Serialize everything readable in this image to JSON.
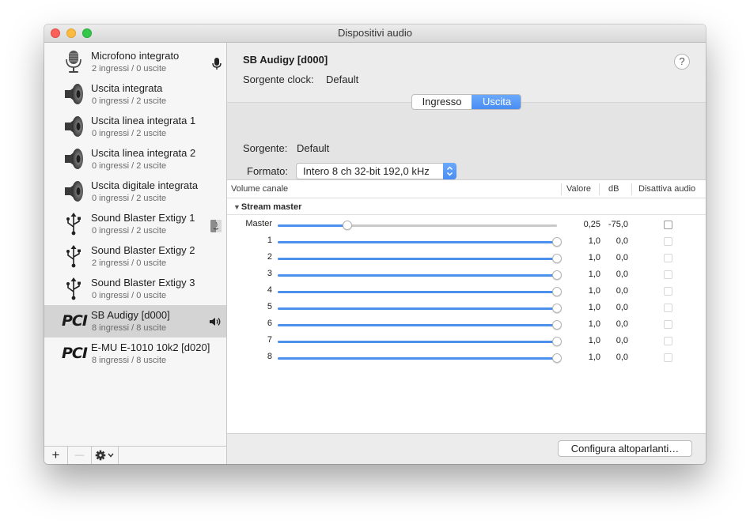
{
  "window": {
    "title": "Dispositivi audio"
  },
  "devices": [
    {
      "name": "Microfono integrato",
      "sub": "2 ingressi / 0 uscite",
      "icon": "microphone-icon",
      "badge": "mic-badge-icon"
    },
    {
      "name": "Uscita integrata",
      "sub": "0 ingressi / 2 uscite",
      "icon": "speaker-icon"
    },
    {
      "name": "Uscita linea integrata 1",
      "sub": "0 ingressi / 2 uscite",
      "icon": "speaker-icon"
    },
    {
      "name": "Uscita linea integrata 2",
      "sub": "0 ingressi / 2 uscite",
      "icon": "speaker-icon"
    },
    {
      "name": "Uscita digitale integrata",
      "sub": "0 ingressi / 2 uscite",
      "icon": "speaker-icon"
    },
    {
      "name": "Sound Blaster Extigy 1",
      "sub": "0 ingressi / 2 uscite",
      "icon": "usb-icon",
      "badge": "finder-badge-icon"
    },
    {
      "name": "Sound Blaster Extigy 2",
      "sub": "2 ingressi / 0 uscite",
      "icon": "usb-icon"
    },
    {
      "name": "Sound Blaster Extigy 3",
      "sub": "0 ingressi / 0 uscite",
      "icon": "usb-icon"
    },
    {
      "name": "SB Audigy [d000]",
      "sub": "8 ingressi / 8 uscite",
      "icon": "pci-icon",
      "icon_text": "PCI",
      "badge": "volume-badge-icon",
      "selected": true
    },
    {
      "name": "E-MU E-1010 10k2 [d020]",
      "sub": "8 ingressi / 8 uscite",
      "icon": "pci-icon",
      "icon_text": "PCI"
    }
  ],
  "sidebar_toolbar": {
    "add": "+",
    "remove": "—"
  },
  "detail": {
    "title": "SB Audigy [d000]",
    "clock_label": "Sorgente clock:",
    "clock_value": "Default",
    "help": "?",
    "tabs": [
      {
        "label": "Ingresso",
        "selected": false
      },
      {
        "label": "Uscita",
        "selected": true
      }
    ],
    "source_label": "Sorgente:",
    "source_value": "Default",
    "format_label": "Formato:",
    "format_value": "Intero 8 ch 32-bit 192,0 kHz"
  },
  "table": {
    "headers": {
      "volume": "Volume canale",
      "value": "Valore",
      "db": "dB",
      "mute": "Disattiva audio"
    },
    "group": "Stream master",
    "rows": [
      {
        "label": "Master",
        "level": 0.25,
        "value": "0,25",
        "db": "-75,0",
        "mute_enabled": true
      },
      {
        "label": "1",
        "level": 1.0,
        "value": "1,0",
        "db": "0,0",
        "mute_enabled": false
      },
      {
        "label": "2",
        "level": 1.0,
        "value": "1,0",
        "db": "0,0",
        "mute_enabled": false
      },
      {
        "label": "3",
        "level": 1.0,
        "value": "1,0",
        "db": "0,0",
        "mute_enabled": false
      },
      {
        "label": "4",
        "level": 1.0,
        "value": "1,0",
        "db": "0,0",
        "mute_enabled": false
      },
      {
        "label": "5",
        "level": 1.0,
        "value": "1,0",
        "db": "0,0",
        "mute_enabled": false
      },
      {
        "label": "6",
        "level": 1.0,
        "value": "1,0",
        "db": "0,0",
        "mute_enabled": false
      },
      {
        "label": "7",
        "level": 1.0,
        "value": "1,0",
        "db": "0,0",
        "mute_enabled": false
      },
      {
        "label": "8",
        "level": 1.0,
        "value": "1,0",
        "db": "0,0",
        "mute_enabled": false
      }
    ]
  },
  "config_button": "Configura altoparlanti…",
  "colors": {
    "accent": "#4b90ec",
    "selection": "#d4d4d4"
  }
}
